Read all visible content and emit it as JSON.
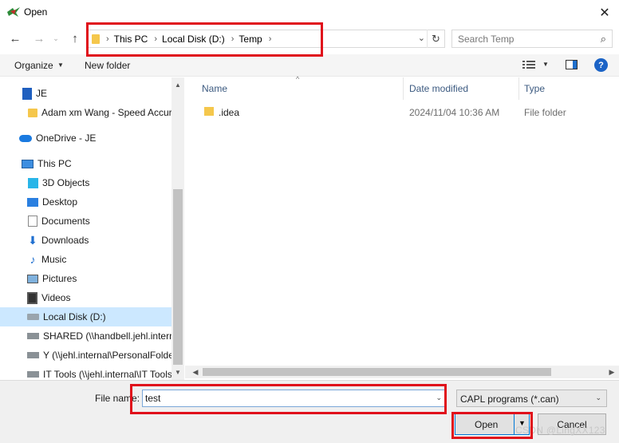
{
  "window": {
    "title": "Open",
    "close_glyph": "✕"
  },
  "nav": {
    "back": "←",
    "forward": "→",
    "recent": "⌄",
    "up": "↑"
  },
  "address": {
    "crumbs": [
      "This PC",
      "Local Disk (D:)",
      "Temp"
    ],
    "sep": "›",
    "dropdown": "⌄",
    "refresh": "↻"
  },
  "search": {
    "placeholder": "Search Temp",
    "icon": "⌕"
  },
  "toolbar": {
    "organize": "Organize",
    "organize_caret": "▼",
    "new_folder": "New folder",
    "view_caret": "▼",
    "help": "?"
  },
  "sidebar": {
    "items": [
      {
        "label": "JE",
        "icon": "document-icon"
      },
      {
        "label": "Adam xm Wang - Speed Accur",
        "icon": "folder-icon"
      },
      {
        "label": "OneDrive - JE",
        "icon": "onedrive-icon"
      },
      {
        "label": "This PC",
        "icon": "computer-icon"
      },
      {
        "label": "3D Objects",
        "icon": "3d-objects-icon"
      },
      {
        "label": "Desktop",
        "icon": "desktop-icon"
      },
      {
        "label": "Documents",
        "icon": "documents-icon"
      },
      {
        "label": "Downloads",
        "icon": "downloads-icon"
      },
      {
        "label": "Music",
        "icon": "music-icon"
      },
      {
        "label": "Pictures",
        "icon": "pictures-icon"
      },
      {
        "label": "Videos",
        "icon": "videos-icon"
      },
      {
        "label": "Local Disk (D:)",
        "icon": "drive-icon"
      },
      {
        "label": "SHARED (\\\\handbell.jehl.intern",
        "icon": "network-drive-icon"
      },
      {
        "label": "Y (\\\\jehl.internal\\PersonalFolde",
        "icon": "network-drive-icon"
      },
      {
        "label": "IT Tools (\\\\jehl.internal\\IT Tools",
        "icon": "network-drive-icon"
      }
    ],
    "selected_index": 11,
    "scroll_up": "▲",
    "scroll_down": "▼"
  },
  "filelist": {
    "columns": [
      "Name",
      "Date modified",
      "Type"
    ],
    "sort_arrow": "^",
    "rows": [
      {
        "name": ".idea",
        "date": "2024/11/04 10:36 AM",
        "type": "File folder"
      }
    ],
    "scroll_left": "◀",
    "scroll_right": "▶"
  },
  "footer": {
    "filename_label": "File name:",
    "filename_value": "test",
    "filename_dropdown": "⌄",
    "filetype_value": "CAPL programs (*.can)",
    "filetype_caret": "⌄",
    "open_label": "Open",
    "open_caret": "▼",
    "cancel_label": "Cancel"
  },
  "watermark": "CSDN @LingXX123",
  "colors": {
    "highlight_red": "#e0101b",
    "selection_blue": "#cce8ff",
    "accent_blue": "#0078d7",
    "folder_yellow": "#f5c74c"
  }
}
